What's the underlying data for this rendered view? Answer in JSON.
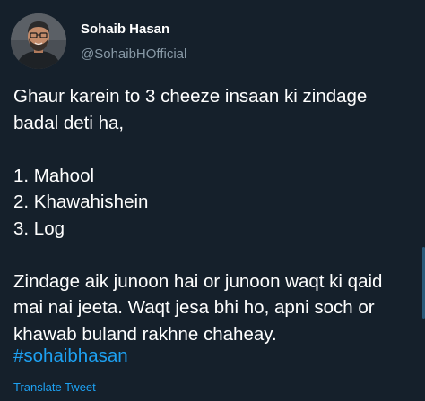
{
  "author": {
    "display_name": "Sohaib Hasan",
    "handle": "@SohaibHOfficial",
    "avatar_icon": "profile-photo-icon"
  },
  "tweet": {
    "lines": [
      "Ghaur karein to 3 cheeze insaan ki zindage",
      "badal deti ha,",
      "",
      "1. Mahool",
      "2. Khawahishein",
      "3. Log",
      "",
      "Zindage aik junoon hai or junoon waqt ki qaid",
      "mai nai jeeta. Waqt jesa bhi ho, apni soch or",
      "khawab buland rakhne chaheay."
    ],
    "hashtag": "#sohaibhasan",
    "translate_label": "Translate Tweet"
  },
  "colors": {
    "background": "#15202b",
    "text": "#ffffff",
    "secondary_text": "#8899a6",
    "link": "#1da1f2"
  }
}
